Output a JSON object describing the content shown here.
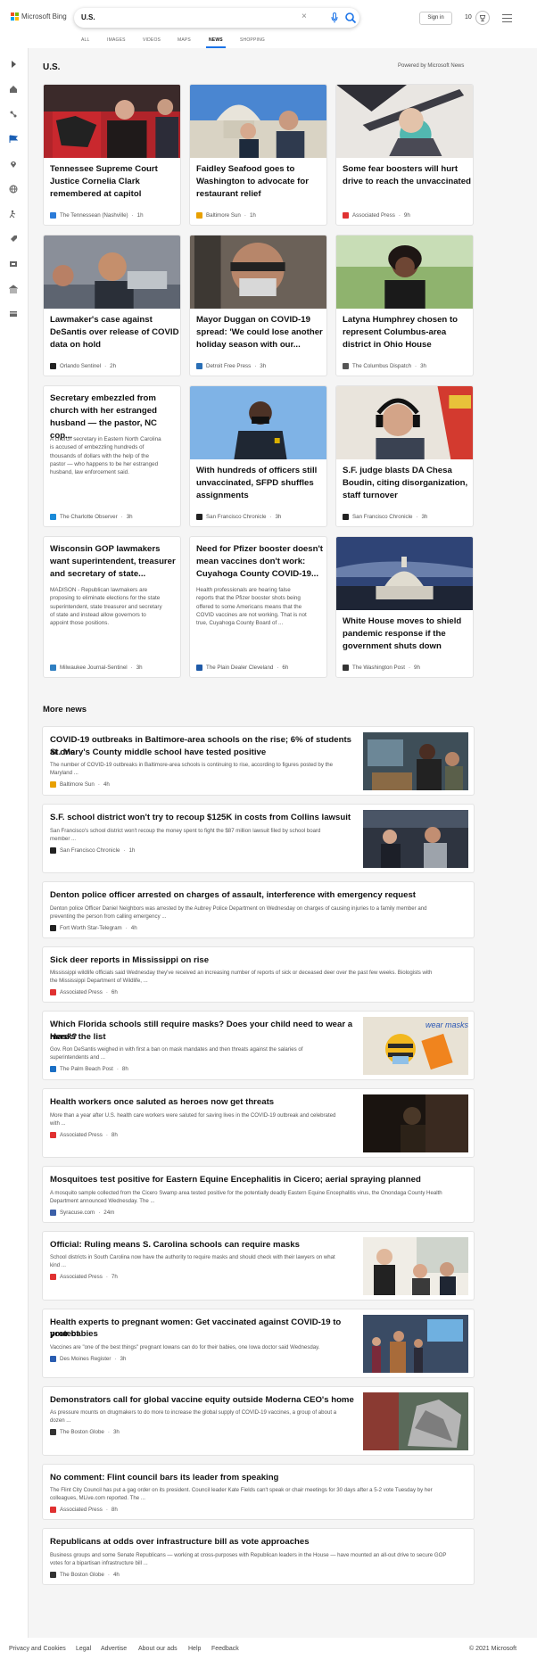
{
  "header": {
    "logo_text": "Microsoft Bing",
    "search_value": "U.S.",
    "signin_label": "Sign in",
    "points": "10"
  },
  "tabs": [
    "ALL",
    "IMAGES",
    "VIDEOS",
    "MAPS",
    "NEWS",
    "SHOPPING"
  ],
  "active_tab": "NEWS",
  "section": {
    "title": "U.S.",
    "powered_by": "Powered by Microsoft News"
  },
  "cards": [
    {
      "title_lines": [
        "Tennessee Supreme Court",
        "Justice Cornelia Clark",
        "remembered at capitol"
      ],
      "source": "The Tennessean (Nashville)",
      "time": "1h",
      "src_color": "#2b7bd8",
      "image": "woman in red at capitol"
    },
    {
      "title_lines": [
        "Faidley Seafood goes to",
        "Washington to advocate for",
        "restaurant relief"
      ],
      "source": "Baltimore Sun",
      "time": "1h",
      "src_color": "#e8a000",
      "image": "capitol dome with people"
    },
    {
      "title_lines": [
        "Some fear boosters will hurt",
        "drive to reach the unvaccinated"
      ],
      "source": "Associated Press",
      "time": "9h",
      "src_color": "#e03131",
      "image": "vaccine syringe"
    },
    {
      "title_lines": [
        "Lawmaker's case against",
        "DeSantis over release of COVID",
        "data on hold"
      ],
      "source": "Orlando Sentinel",
      "time": "2h",
      "src_color": "#222222",
      "image": "man smiling"
    },
    {
      "title_lines": [
        "Mayor Duggan on COVID-19",
        "spread: 'We could lose another",
        "holiday season with our..."
      ],
      "source": "Detroit Free Press",
      "time": "3h",
      "src_color": "#2a6fb6",
      "image": "man with glasses and mask"
    },
    {
      "title_lines": [
        "Latyna Humphrey chosen to",
        "represent Columbus-area",
        "district in Ohio House"
      ],
      "source": "The Columbus Dispatch",
      "time": "3h",
      "src_color": "#555555",
      "image": "woman smiling"
    },
    {
      "title_lines": [
        "Secretary embezzled from",
        "church with her estranged",
        "husband — the pastor, NC cop..."
      ],
      "snippet_lines": [
        "A church secretary in Eastern North Carolina",
        "is accused of embezzling hundreds of",
        "thousands of dollars with the help of the",
        "pastor — who happens to be her estranged",
        "husband, law enforcement said."
      ],
      "source": "The Charlotte Observer",
      "time": "3h",
      "src_color": "#1b8ad8"
    },
    {
      "title_lines": [
        "With hundreds of officers still",
        "unvaccinated, SFPD shuffles",
        "assignments"
      ],
      "source": "San Francisco Chronicle",
      "time": "3h",
      "src_color": "#222222",
      "image": "police officer with mask"
    },
    {
      "title_lines": [
        "S.F. judge blasts DA Chesa",
        "Boudin, citing disorganization,",
        "staff turnover"
      ],
      "source": "San Francisco Chronicle",
      "time": "3h",
      "src_color": "#222222",
      "image": "man with headphones"
    },
    {
      "title_lines": [
        "Wisconsin GOP lawmakers",
        "want superintendent, treasurer",
        "and secretary of state..."
      ],
      "snippet_lines": [
        "MADISON - Republican lawmakers are",
        "proposing to eliminate elections for the state",
        "superintendent, state treasurer and secretary",
        "of state and instead allow governors to",
        "appoint those positions."
      ],
      "source": "Milwaukee Journal-Sentinel",
      "time": "3h",
      "src_color": "#2f7fc1"
    },
    {
      "title_lines": [
        "Need for Pfizer booster doesn't",
        "mean vaccines don't work:",
        "Cuyahoga County COVID-19..."
      ],
      "snippet_lines": [
        "Health professionals are hearing false",
        "reports that the Pfizer booster shots being",
        "offered to some Americans means that the",
        "COVID vaccines are not working. That is not",
        "true, Cuyahoga County Board of ..."
      ],
      "source": "The Plain Dealer Cleveland",
      "time": "6h",
      "src_color": "#1e5aa8"
    },
    {
      "title_lines": [
        "White House moves to shield",
        "pandemic response if the",
        "government shuts down"
      ],
      "source": "The Washington Post",
      "time": "9h",
      "src_color": "#333333",
      "image": "capitol at dusk"
    }
  ],
  "more_news": {
    "title": "More news",
    "items": [
      {
        "title_lines": [
          "COVID-19 outbreaks in Baltimore-area schools on the rise; 6% of students at one",
          "St. Mary's County middle school have tested positive"
        ],
        "snippet_lines": [
          "The number of COVID-19 outbreaks in Baltimore-area schools is continuing to rise, according to figures posted by the",
          "Maryland ..."
        ],
        "source": "Baltimore Sun",
        "time": "4h",
        "src_color": "#e8a000",
        "image": "students in classroom"
      },
      {
        "title_lines": [
          "S.F. school district won't try to recoup $125K in costs from Collins lawsuit"
        ],
        "snippet_lines": [
          "San Francisco's school district won't recoup the money spent to fight the $87 million lawsuit filed by school board",
          "member ..."
        ],
        "source": "San Francisco Chronicle",
        "time": "1h",
        "src_color": "#222222",
        "image": "school board meeting"
      },
      {
        "title_lines": [
          "Denton police officer arrested on charges of assault, interference with emergency request"
        ],
        "snippet_lines": [
          "Denton police Officer Daniel Neighbors was arrested by the Aubrey Police Department on Wednesday on charges of causing injuries to a family member and",
          "preventing the person from calling emergency ..."
        ],
        "source": "Fort Worth Star-Telegram",
        "time": "4h",
        "src_color": "#222222"
      },
      {
        "title_lines": [
          "Sick deer reports in Mississippi on rise"
        ],
        "snippet_lines": [
          "Mississippi wildlife officials said Wednesday they've received an increasing number of reports of sick or deceased deer over the past few weeks. Biologists with",
          "the Mississippi Department of Wildlife, ..."
        ],
        "source": "Associated Press",
        "time": "6h",
        "src_color": "#e03131"
      },
      {
        "title_lines": [
          "Which Florida schools still require masks? Does your child need to wear a mask?",
          "Here's the list"
        ],
        "snippet_lines": [
          "Gov. Ron DeSantis weighed in with first a ban on mask mandates and then threats against the salaries of",
          "superintendents and ..."
        ],
        "source": "The Palm Beach Post",
        "time": "8h",
        "src_color": "#1c6fc4",
        "image": "bee wearing a mask",
        "image_text": "wear masks!"
      },
      {
        "title_lines": [
          "Health workers once saluted as heroes now get threats"
        ],
        "snippet_lines": [
          "More than a year after U.S. health care workers were saluted for saving lives in the COVID-19 outbreak and celebrated",
          "with ..."
        ],
        "source": "Associated Press",
        "time": "8h",
        "src_color": "#e03131",
        "image": "health worker silhouette"
      },
      {
        "title_lines": [
          "Mosquitoes test positive for Eastern Equine Encephalitis in Cicero; aerial spraying planned"
        ],
        "snippet_lines": [
          "A mosquito sample collected from the Cicero Swamp area tested positive for the potentially deadly Eastern Equine Encephalitis virus, the Onondaga County Health",
          "Department announced Wednesday. The ..."
        ],
        "source": "Syracuse.com",
        "time": "24m",
        "src_color": "#3b5fa8"
      },
      {
        "title_lines": [
          "Official: Ruling means S. Carolina schools can require masks"
        ],
        "snippet_lines": [
          "School districts in South Carolina now have the authority to require masks and should check with their lawyers on what",
          "kind ..."
        ],
        "source": "Associated Press",
        "time": "7h",
        "src_color": "#e03131",
        "image": "officials at hearing"
      },
      {
        "title_lines": [
          "Health experts to pregnant women: Get vaccinated against COVID-19 to protect",
          "your babies"
        ],
        "snippet_lines": [
          "Vaccines are \"one of the best things\" pregnant Iowans can do for their babies, one Iowa doctor said Wednesday."
        ],
        "source": "Des Moines Register",
        "time": "3h",
        "src_color": "#2a5db0",
        "image": "press conference"
      },
      {
        "title_lines": [
          "Demonstrators call for global vaccine equity outside Moderna CEO's home"
        ],
        "snippet_lines": [
          "As pressure mounts on drugmakers to do more to increase the global supply of COVID-19 vaccines, a group of about a",
          "dozen ..."
        ],
        "source": "The Boston Globe",
        "time": "3h",
        "src_color": "#333333",
        "image": "demonstration display"
      },
      {
        "title_lines": [
          "No comment: Flint council bars its leader from speaking"
        ],
        "snippet_lines": [
          "The Flint City Council has put a gag order on its president. Council leader Kate Fields can't speak or chair meetings for 30 days after a 5-2 vote Tuesday by her",
          "colleagues, MLive.com reported. The ..."
        ],
        "source": "Associated Press",
        "time": "8h",
        "src_color": "#e03131"
      },
      {
        "title_lines": [
          "Republicans at odds over infrastructure bill as vote approaches"
        ],
        "snippet_lines": [
          "Business groups and some Senate Republicans — working at cross-purposes with Republican leaders in the House — have mounted an all-out drive to secure GOP",
          "votes for a bipartisan infrastructure bill ..."
        ],
        "source": "The Boston Globe",
        "time": "4h",
        "src_color": "#333333"
      }
    ]
  },
  "footer": {
    "links": [
      "Privacy and Cookies",
      "Legal",
      "Advertise",
      "About our ads",
      "Help",
      "Feedback"
    ],
    "copyright": "© 2021 Microsoft"
  }
}
